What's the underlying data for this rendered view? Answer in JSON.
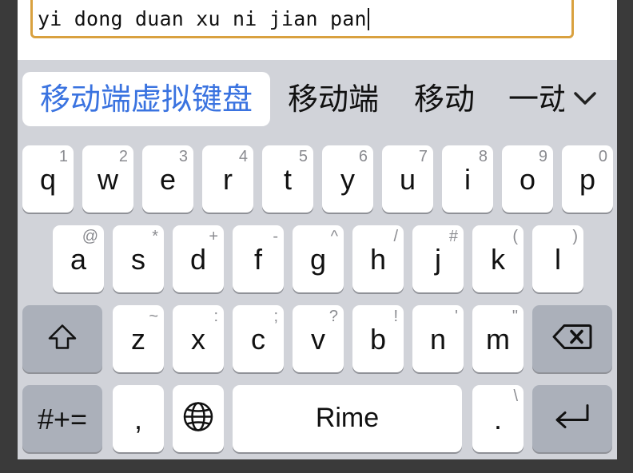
{
  "input": {
    "value": "yi dong duan xu ni jian pan"
  },
  "candidates": {
    "items": [
      "移动端虚拟键盘",
      "移动端",
      "移动",
      "一动"
    ],
    "selected_index": 0,
    "highlight_color": "#3a73e0",
    "expand_icon": "chevron-down-icon"
  },
  "keyboard": {
    "row1": [
      {
        "label": "q",
        "sub": "1"
      },
      {
        "label": "w",
        "sub": "2"
      },
      {
        "label": "e",
        "sub": "3"
      },
      {
        "label": "r",
        "sub": "4"
      },
      {
        "label": "t",
        "sub": "5"
      },
      {
        "label": "y",
        "sub": "6"
      },
      {
        "label": "u",
        "sub": "7"
      },
      {
        "label": "i",
        "sub": "8"
      },
      {
        "label": "o",
        "sub": "9"
      },
      {
        "label": "p",
        "sub": "0"
      }
    ],
    "row2": [
      {
        "label": "a",
        "sub": "@"
      },
      {
        "label": "s",
        "sub": "*"
      },
      {
        "label": "d",
        "sub": "+"
      },
      {
        "label": "f",
        "sub": "-"
      },
      {
        "label": "g",
        "sub": "^"
      },
      {
        "label": "h",
        "sub": "/"
      },
      {
        "label": "j",
        "sub": "#"
      },
      {
        "label": "k",
        "sub": "("
      },
      {
        "label": "l",
        "sub": ")"
      }
    ],
    "row3": [
      {
        "label": "z",
        "sub": "~"
      },
      {
        "label": "x",
        "sub": ":"
      },
      {
        "label": "c",
        "sub": ";"
      },
      {
        "label": "v",
        "sub": "?"
      },
      {
        "label": "b",
        "sub": "!"
      },
      {
        "label": "n",
        "sub": "'"
      },
      {
        "label": "m",
        "sub": "\""
      }
    ],
    "shift_icon": "shift-icon",
    "backspace_icon": "backspace-icon",
    "symbols_label": "#+=",
    "comma_label": ",",
    "globe_icon": "globe-icon",
    "space_label": "Rime",
    "period_label": ".",
    "period_sub": "\\",
    "return_icon": "return-icon"
  }
}
